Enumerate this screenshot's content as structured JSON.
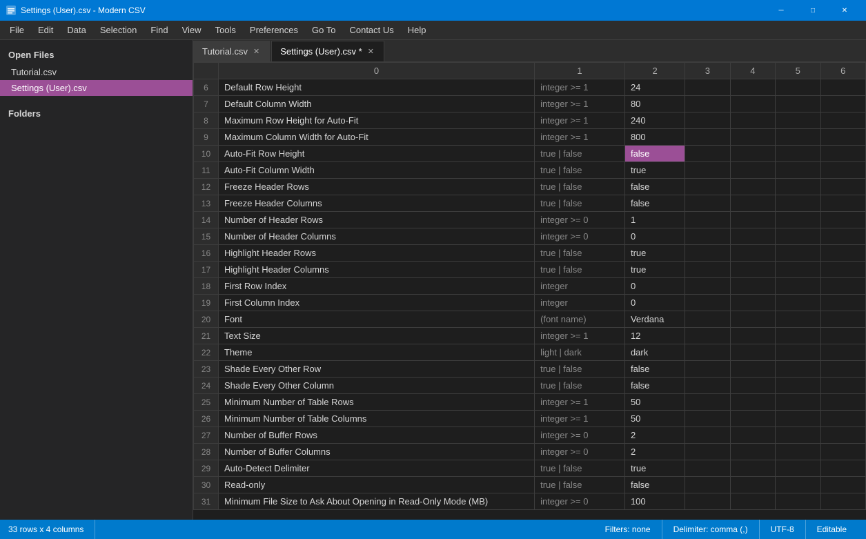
{
  "titlebar": {
    "title": "Settings (User).csv - Modern CSV",
    "min_label": "─",
    "max_label": "□",
    "close_label": "✕"
  },
  "menubar": {
    "items": [
      "File",
      "Edit",
      "Data",
      "Selection",
      "Find",
      "View",
      "Tools",
      "Preferences",
      "Go To",
      "Contact Us",
      "Help"
    ]
  },
  "sidebar": {
    "open_files_label": "Open Files",
    "folders_label": "Folders",
    "files": [
      {
        "name": "Tutorial.csv",
        "active": false
      },
      {
        "name": "Settings (User).csv",
        "active": true
      }
    ]
  },
  "tabs": [
    {
      "label": "Tutorial.csv",
      "active": false,
      "modified": false
    },
    {
      "label": "Settings (User).csv",
      "active": true,
      "modified": true
    }
  ],
  "grid": {
    "columns": [
      "",
      "0",
      "1",
      "2",
      "3",
      "4",
      "5",
      "6"
    ],
    "rows": [
      {
        "num": "6",
        "c0": "Default Row Height",
        "c1": "integer >= 1",
        "c2": "24",
        "c3": "",
        "selected_col": -1
      },
      {
        "num": "7",
        "c0": "Default Column Width",
        "c1": "integer >= 1",
        "c2": "80",
        "c3": ""
      },
      {
        "num": "8",
        "c0": "Maximum Row Height for Auto-Fit",
        "c1": "integer >= 1",
        "c2": "240",
        "c3": ""
      },
      {
        "num": "9",
        "c0": "Maximum Column Width for Auto-Fit",
        "c1": "integer >= 1",
        "c2": "800",
        "c3": ""
      },
      {
        "num": "10",
        "c0": "Auto-Fit Row Height",
        "c1": "true | false",
        "c2": "false",
        "c3": "",
        "selected_col": 2
      },
      {
        "num": "11",
        "c0": "Auto-Fit Column Width",
        "c1": "true | false",
        "c2": "true",
        "c3": ""
      },
      {
        "num": "12",
        "c0": "Freeze Header Rows",
        "c1": "true | false",
        "c2": "false",
        "c3": ""
      },
      {
        "num": "13",
        "c0": "Freeze Header Columns",
        "c1": "true | false",
        "c2": "false",
        "c3": ""
      },
      {
        "num": "14",
        "c0": "Number of Header Rows",
        "c1": "integer >= 0",
        "c2": "1",
        "c3": ""
      },
      {
        "num": "15",
        "c0": "Number of Header Columns",
        "c1": "integer >= 0",
        "c2": "0",
        "c3": ""
      },
      {
        "num": "16",
        "c0": "Highlight Header Rows",
        "c1": "true | false",
        "c2": "true",
        "c3": ""
      },
      {
        "num": "17",
        "c0": "Highlight Header Columns",
        "c1": "true | false",
        "c2": "true",
        "c3": ""
      },
      {
        "num": "18",
        "c0": "First Row Index",
        "c1": "integer",
        "c2": "0",
        "c3": ""
      },
      {
        "num": "19",
        "c0": "First Column Index",
        "c1": "integer",
        "c2": "0",
        "c3": ""
      },
      {
        "num": "20",
        "c0": "Font",
        "c1": "(font name)",
        "c2": "Verdana",
        "c3": ""
      },
      {
        "num": "21",
        "c0": "Text Size",
        "c1": "integer >= 1",
        "c2": "12",
        "c3": ""
      },
      {
        "num": "22",
        "c0": "Theme",
        "c1": "light | dark",
        "c2": "dark",
        "c3": ""
      },
      {
        "num": "23",
        "c0": "Shade Every Other Row",
        "c1": "true | false",
        "c2": "false",
        "c3": ""
      },
      {
        "num": "24",
        "c0": "Shade Every Other Column",
        "c1": "true | false",
        "c2": "false",
        "c3": ""
      },
      {
        "num": "25",
        "c0": "Minimum Number of Table Rows",
        "c1": "integer >= 1",
        "c2": "50",
        "c3": ""
      },
      {
        "num": "26",
        "c0": "Minimum Number of Table Columns",
        "c1": "integer >= 1",
        "c2": "50",
        "c3": ""
      },
      {
        "num": "27",
        "c0": "Number of Buffer Rows",
        "c1": "integer >= 0",
        "c2": "2",
        "c3": ""
      },
      {
        "num": "28",
        "c0": "Number of Buffer Columns",
        "c1": "integer >= 0",
        "c2": "2",
        "c3": ""
      },
      {
        "num": "29",
        "c0": "Auto-Detect Delimiter",
        "c1": "true | false",
        "c2": "true",
        "c3": ""
      },
      {
        "num": "30",
        "c0": "Read-only",
        "c1": "true | false",
        "c2": "false",
        "c3": ""
      },
      {
        "num": "31",
        "c0": "Minimum File Size to Ask About Opening in Read-Only Mode (MB)",
        "c1": "integer >= 0",
        "c2": "100",
        "c3": ""
      }
    ]
  },
  "statusbar": {
    "rows_cols": "33 rows x 4 columns",
    "filters": "Filters: none",
    "delimiter": "Delimiter: comma (,)",
    "encoding": "UTF-8",
    "mode": "Editable"
  }
}
